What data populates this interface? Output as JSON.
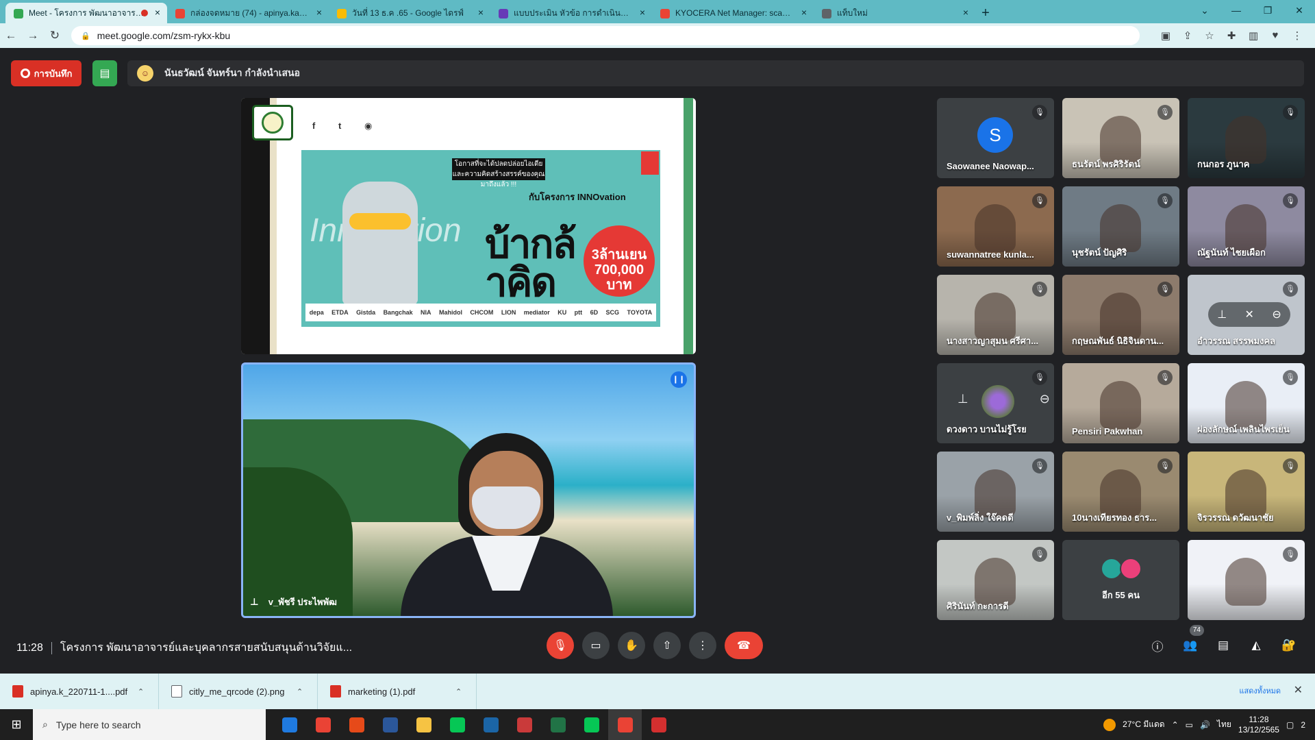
{
  "browser": {
    "tabs": [
      {
        "title": "Meet - โครงการ พัฒนาอาจารย์และ",
        "color": "#34a853",
        "active": true,
        "recording": true
      },
      {
        "title": "กล่องจดหมาย (74) - apinya.kae@n",
        "color": "#ea4335",
        "active": false
      },
      {
        "title": "วันที่ 13 ธ.ค .65 - Google ไดรฟ์",
        "color": "#fbbc04",
        "active": false
      },
      {
        "title": "แบบประเมิน หัวข้อ การดำเนินการวิจัย",
        "color": "#673ab7",
        "active": false
      },
      {
        "title": "KYOCERA Net Manager: scanned",
        "color": "#ea4335",
        "active": false
      },
      {
        "title": "แท็บใหม่",
        "color": "#5f6368",
        "active": false
      }
    ],
    "new_tab": "+",
    "window_controls": [
      "⌄",
      "—",
      "❐",
      "✕"
    ],
    "url": "meet.google.com/zsm-rykx-kbu"
  },
  "meet": {
    "record_label": "การบันทึก",
    "presenter_text": "นันธวัฒน์ จันทร์นา กำลังนำเสนอ",
    "slide": {
      "social": [
        "f",
        "t",
        "◉"
      ],
      "poster_tagline": "โอกาสที่จะได้ปลดปล่อยไอเดีย และความคิดสร้างสรรค์ของคุณมาถึงแล้ว !!!",
      "poster_program": "กับโครงการ INNOvation",
      "poster_title": "บ้ากล้าคิด",
      "poster_prize": "3ล้านเยน 700,000 บาท",
      "sponsors": [
        "depa",
        "ETDA",
        "Gistda",
        "Bangchak",
        "NIA",
        "Mahidol",
        "CHCOM",
        "LION",
        "mediator",
        "KU",
        "ptt",
        "6D",
        "SCG",
        "TOYOTA"
      ]
    },
    "speaker_name": "v_พัชรี ประไพพัฒ",
    "tiles": [
      {
        "name": "Saowanee Naowap...",
        "type": "avatar",
        "initial": "S",
        "bg": "#3c4043",
        "av": "#1a73e8"
      },
      {
        "name": "ธนรัตน์ พรศิริรัตน์",
        "type": "video",
        "bg": "#c9c3b6"
      },
      {
        "name": "กนกอร ภูนาค",
        "type": "video",
        "bg": "#2b3a3f"
      },
      {
        "name": "suwannatree kunla...",
        "type": "video",
        "bg": "#8c6a4f"
      },
      {
        "name": "นุชรัตน์ ปัญศิริ",
        "type": "video",
        "bg": "#6f7b85"
      },
      {
        "name": "ณัฐนันท์ ไชยเผือก",
        "type": "video",
        "bg": "#8e8aa0"
      },
      {
        "name": "นางสาวญาสุมน ศรีศา...",
        "type": "video",
        "bg": "#b7b4ac"
      },
      {
        "name": "กฤษณพันธ์ นิธิจินดาน...",
        "type": "video",
        "bg": "#8d7b6c"
      },
      {
        "name": "อำวรรณ สรรพมงคล",
        "type": "hover",
        "bg": "#bfc5cc"
      },
      {
        "name": "ดวงดาว บานไม่รู้โรย",
        "type": "flower",
        "bg": "#3c4043"
      },
      {
        "name": "Pensiri Pakwhan",
        "type": "video",
        "bg": "#b6aa9b"
      },
      {
        "name": "ผ่องลักษณ์ เพลินไพรเย็น",
        "type": "video",
        "bg": "#e9eef6"
      },
      {
        "name": "v_พิมพ์ลิ่ง ใจ๊คดดี",
        "type": "video",
        "bg": "#9aa2a8"
      },
      {
        "name": "10นางเทียรทอง ธาร...",
        "type": "video",
        "bg": "#9a8a70"
      },
      {
        "name": "จิรวรรณ ดวัฒนาชัย",
        "type": "video",
        "bg": "#c8b67a"
      },
      {
        "name": "ศิรินันท์ กะการดี",
        "type": "video",
        "bg": "#c3c7c4"
      },
      {
        "name": "อีก 55 คน",
        "type": "more",
        "bg": "#3c4043"
      },
      {
        "name": "",
        "type": "video",
        "bg": "#f0f2f7"
      }
    ],
    "time": "11:28",
    "meeting_title": "โครงการ พัฒนาอาจารย์และบุคลากรสายสนับสนุนด้านวิจัยแ...",
    "participant_count": "74"
  },
  "downloads": {
    "items": [
      {
        "name": "apinya.k_220711-1....pdf",
        "kind": "pdf"
      },
      {
        "name": "citly_me_qrcode (2).png",
        "kind": "img"
      },
      {
        "name": "marketing (1).pdf",
        "kind": "pdf"
      }
    ],
    "show_all": "แสดงทั้งหมด"
  },
  "taskbar": {
    "search_placeholder": "Type here to search",
    "apps": [
      "#1f7ae0",
      "#ea4335",
      "#e64a19",
      "#2b579a",
      "#f6c343",
      "#06c755",
      "#1b65a6",
      "#c93a3a",
      "#217346",
      "#06c755",
      "#ea4335",
      "#d32f2f"
    ],
    "weather": "27°C มีแดด",
    "lang": "ไทย",
    "clock_time": "11:28",
    "clock_date": "13/12/2565",
    "notif_count": "2"
  }
}
